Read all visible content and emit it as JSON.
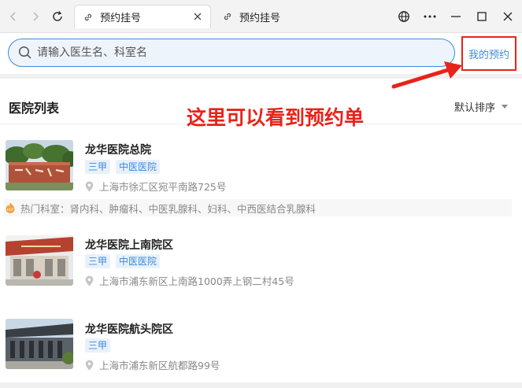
{
  "browser": {
    "tabs": [
      {
        "label": "预约挂号",
        "active": true
      },
      {
        "label": "预约挂号",
        "active": false
      }
    ]
  },
  "search": {
    "placeholder": "请输入医生名、科室名",
    "value": ""
  },
  "header": {
    "my_appointments": "我的预约"
  },
  "list": {
    "title": "医院列表",
    "sort_label": "默认排序"
  },
  "annotation": {
    "text": "这里可以看到预约单",
    "color": "#e8231a"
  },
  "hospitals": [
    {
      "name": "龙华医院总院",
      "tags": [
        "三甲",
        "中医医院"
      ],
      "address": "上海市徐汇区宛平南路725号",
      "hot_depts": "热门科室：肾内科、肿瘤科、中医乳腺科、妇科、中西医结合乳腺科"
    },
    {
      "name": "龙华医院上南院区",
      "tags": [
        "三甲",
        "中医医院"
      ],
      "address": "上海市浦东新区上南路1000弄上钢二村45号"
    },
    {
      "name": "龙华医院航头院区",
      "tags": [
        "三甲"
      ],
      "address": "上海市浦东新区航都路99号"
    }
  ],
  "colors": {
    "accent": "#3d8bd9",
    "highlight": "#e8231a",
    "tag_bg": "#e8f1fb"
  }
}
